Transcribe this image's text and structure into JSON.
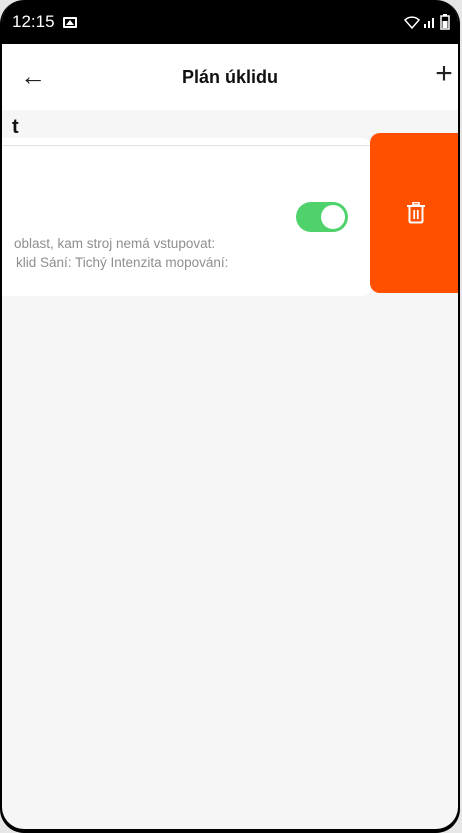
{
  "status_bar": {
    "time": "12:15"
  },
  "header": {
    "title": "Plán úklidu",
    "back_icon": "←",
    "add_icon": "+"
  },
  "section": {
    "label": "t"
  },
  "plan_card": {
    "enabled": true,
    "description_line1": "oblast, kam stroj nemá vstupovat:",
    "description_line2": "klid  Sání: Tichý  Intenzita mopování:"
  },
  "delete_action": {
    "icon": "trash-icon",
    "color": "#ff5000"
  },
  "colors": {
    "toggle_on": "#4fd26b",
    "background": "#f6f6f6"
  }
}
